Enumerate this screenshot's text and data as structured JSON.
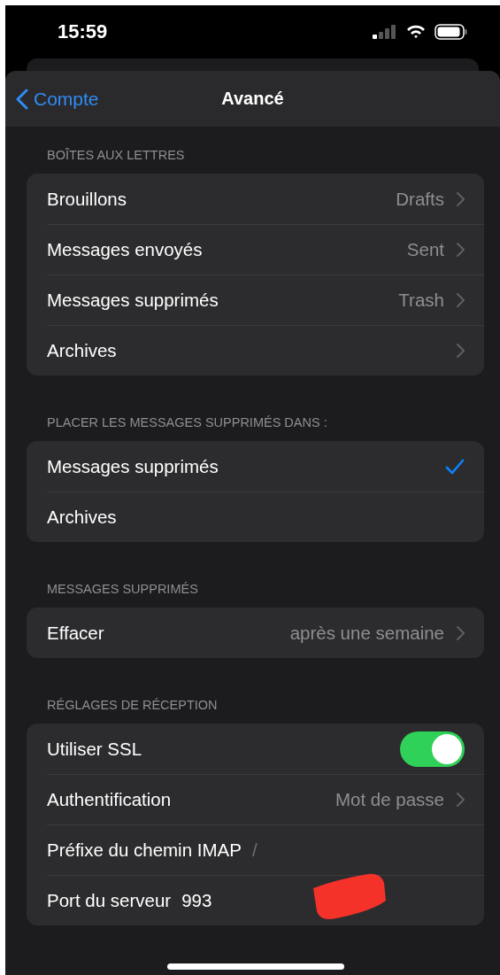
{
  "status_bar": {
    "time": "15:59"
  },
  "nav": {
    "back": "Compte",
    "title": "Avancé"
  },
  "sections": [
    {
      "header": "BOÎTES AUX LETTRES",
      "rows": [
        {
          "kind": "link",
          "label": "Brouillons",
          "value": "Drafts"
        },
        {
          "kind": "link",
          "label": "Messages envoyés",
          "value": "Sent"
        },
        {
          "kind": "link",
          "label": "Messages supprimés",
          "value": "Trash"
        },
        {
          "kind": "link",
          "label": "Archives"
        }
      ]
    },
    {
      "header": "PLACER LES MESSAGES SUPPRIMÉS DANS :",
      "rows": [
        {
          "kind": "choice",
          "label": "Messages supprimés",
          "selected": true
        },
        {
          "kind": "choice",
          "label": "Archives",
          "selected": false
        }
      ]
    },
    {
      "header": "MESSAGES SUPPRIMÉS",
      "rows": [
        {
          "kind": "link",
          "label": "Effacer",
          "value": "après une semaine"
        }
      ]
    },
    {
      "header": "RÉGLAGES DE RÉCEPTION",
      "rows": [
        {
          "kind": "toggle",
          "label": "Utiliser SSL",
          "on": true
        },
        {
          "kind": "link",
          "label": "Authentification",
          "value": "Mot de passe"
        },
        {
          "kind": "field",
          "label": "Préfixe du chemin IMAP",
          "placeholder": "/"
        },
        {
          "kind": "field",
          "label": "Port du serveur",
          "value": "993"
        }
      ]
    }
  ]
}
